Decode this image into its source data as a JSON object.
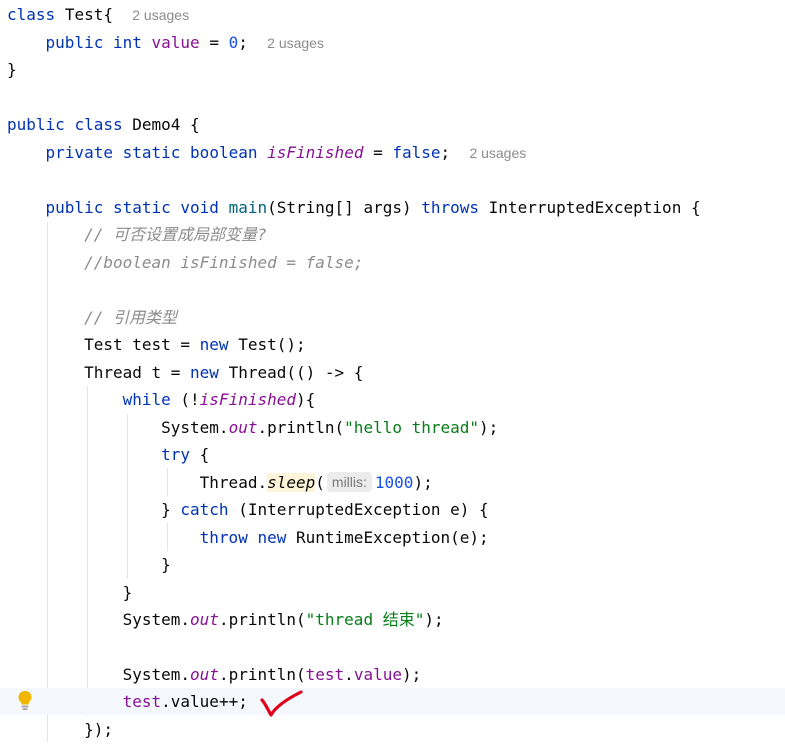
{
  "editor": {
    "lines": {
      "l1": {
        "kw": "class",
        "name": "Test{",
        "hint": "2 usages"
      },
      "l2": {
        "kw1": "public",
        "kw2": "int",
        "field": "value",
        "eq": " = ",
        "num": "0",
        "semi": ";",
        "hint": "2 usages"
      },
      "l3": {
        "text": "}"
      },
      "l5": {
        "kw1": "public",
        "kw2": "class",
        "name": "Demo4 {"
      },
      "l6": {
        "kw1": "private",
        "kw2": "static",
        "kw3": "boolean",
        "field": "isFinished",
        "eq": " = ",
        "kw4": "false",
        "semi": ";",
        "hint": "2 usages"
      },
      "l8": {
        "kw1": "public",
        "kw2": "static",
        "kw3": "void",
        "method": "main",
        "params": "(String[] args) ",
        "kw4": "throws",
        "rest": " InterruptedException {"
      },
      "l9": {
        "comment": "// 可否设置成局部变量?"
      },
      "l10": {
        "comment": "//boolean isFinished = false;"
      },
      "l12": {
        "comment": "// 引用类型"
      },
      "l13": {
        "pre": "Test test = ",
        "kw": "new",
        "post": " Test();"
      },
      "l14": {
        "pre": "Thread t = ",
        "kw": "new",
        "post": " Thread(() -> {"
      },
      "l15": {
        "kw": "while",
        "pre": " (!",
        "field": "isFinished",
        "post": "){"
      },
      "l16": {
        "pre": "System.",
        "field": "out",
        "mid": ".println(",
        "str": "\"hello thread\"",
        "post": ");"
      },
      "l17": {
        "kw": "try",
        "post": " {"
      },
      "l18": {
        "pre": "Thread.",
        "method": "sleep",
        "open": "(",
        "param_hint": "millis:",
        "num": "1000",
        "post": ");"
      },
      "l19": {
        "pre": "} ",
        "kw": "catch",
        "post": " (InterruptedException e) {"
      },
      "l20": {
        "kw1": "throw",
        "kw2": "new",
        "post": " RuntimeException(e);"
      },
      "l21": {
        "text": "}"
      },
      "l22": {
        "text": "}"
      },
      "l23": {
        "pre": "System.",
        "field": "out",
        "mid": ".println(",
        "str": "\"thread 结束\"",
        "post": ");"
      },
      "l25": {
        "pre": "System.",
        "field": "out",
        "mid": ".println(",
        "var": "test",
        "dot": ".",
        "field2": "value",
        "post": ");"
      },
      "l26": {
        "var": "test",
        "dot": ".",
        "field": "value",
        "post": "++;"
      },
      "l27": {
        "text": "});"
      }
    },
    "colors": {
      "keyword": "#0033b3",
      "field": "#871094",
      "number": "#1750eb",
      "string": "#067d17",
      "comment": "#8c8c8c",
      "current_line": "#f5f8fe",
      "annotation_mark": "#e0001a"
    },
    "icons": {
      "gutter": "lightbulb-icon",
      "annotation": "red-checkmark"
    }
  }
}
